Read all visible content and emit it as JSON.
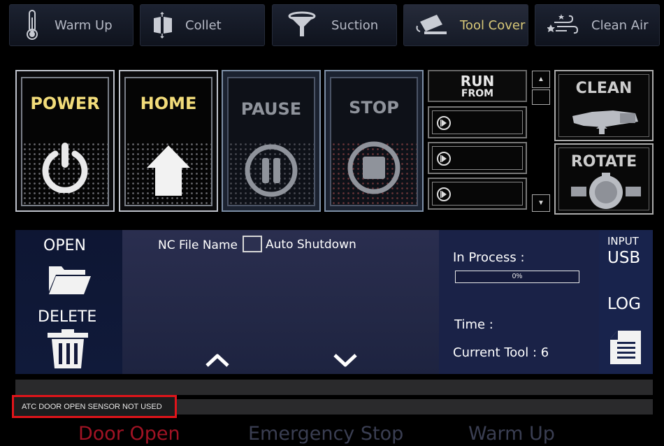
{
  "top_tabs": [
    {
      "label": "Warm Up",
      "icon": "thermometer-icon",
      "active": false
    },
    {
      "label": "Collet",
      "icon": "collet-icon",
      "active": false
    },
    {
      "label": "Suction",
      "icon": "funnel-icon",
      "active": false
    },
    {
      "label": "Tool Cover",
      "icon": "tool-cover-icon",
      "active": true
    },
    {
      "label": "Clean Air",
      "icon": "clean-air-icon",
      "active": false
    }
  ],
  "controls": {
    "power": "POWER",
    "home": "HOME",
    "pause": "PAUSE",
    "stop": "STOP"
  },
  "run_from": {
    "line1": "RUN",
    "line2": "FROM"
  },
  "side_buttons": {
    "clean": "CLEAN",
    "rotate": "ROTATE"
  },
  "file_panel": {
    "open_label": "OPEN",
    "delete_label": "DELETE",
    "nc_file_name_label": "NC File Name",
    "auto_shutdown_label": "Auto Shutdown",
    "auto_shutdown_checked": false,
    "in_process_label": "In Process :",
    "progress_text": "0%",
    "progress_value": 0,
    "time_label": "Time :",
    "current_tool_label": "Current Tool : 6",
    "input_label": "INPUT",
    "usb_label": "USB",
    "log_label": "LOG"
  },
  "message": "ATC DOOR OPEN SENSOR NOT USED",
  "status_bar": {
    "door_open": "Door Open",
    "emergency_stop": "Emergency Stop",
    "warm_up": "Warm Up"
  },
  "colors": {
    "active_tab": "#d8c878",
    "power_home_title": "#f2dc7a",
    "door_open": "#a01324",
    "inactive_status": "#3a3e52",
    "message_border": "#e0141a"
  }
}
